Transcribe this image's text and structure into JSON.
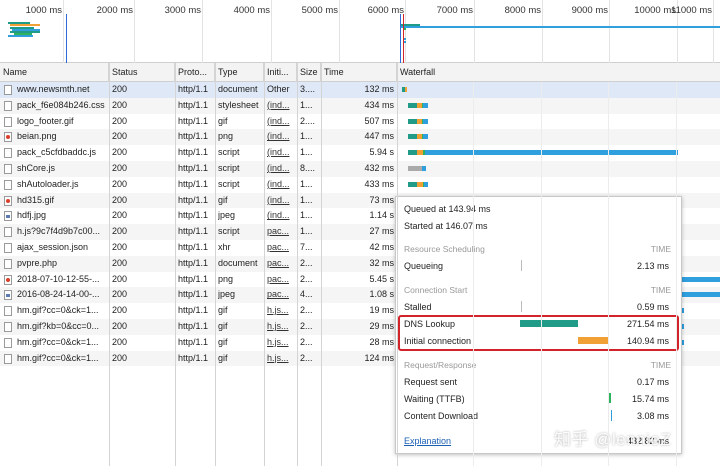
{
  "overview": {
    "tick_labels": [
      "1000 ms",
      "2000 ms",
      "3000 ms",
      "4000 ms",
      "5000 ms",
      "6000 ms",
      "7000 ms",
      "8000 ms",
      "9000 ms",
      "10000 ms",
      "11000 ms"
    ]
  },
  "columns": [
    "Name",
    "Status",
    "Proto...",
    "Type",
    "Initi...",
    "Size",
    "Time",
    "Waterfall"
  ],
  "rows": [
    {
      "name": "www.newsmth.net",
      "status": "200",
      "proto": "http/1.1",
      "type": "document",
      "init": "Other",
      "size": "3....",
      "time": "132 ms",
      "icon": "document-icon"
    },
    {
      "name": "pack_f6e084b246.css",
      "status": "200",
      "proto": "http/1.1",
      "type": "stylesheet",
      "init": "(ind...",
      "size": "1...",
      "time": "434 ms",
      "icon": "stylesheet-icon"
    },
    {
      "name": "logo_footer.gif",
      "status": "200",
      "proto": "http/1.1",
      "type": "gif",
      "init": "(ind...",
      "size": "2....",
      "time": "507 ms",
      "icon": "image-icon"
    },
    {
      "name": "beian.png",
      "status": "200",
      "proto": "http/1.1",
      "type": "png",
      "init": "(ind...",
      "size": "1...",
      "time": "447 ms",
      "icon": "png-icon"
    },
    {
      "name": "pack_c5cfdbaddc.js",
      "status": "200",
      "proto": "http/1.1",
      "type": "script",
      "init": "(ind...",
      "size": "1...",
      "time": "5.94 s",
      "icon": "script-icon"
    },
    {
      "name": "shCore.js",
      "status": "200",
      "proto": "http/1.1",
      "type": "script",
      "init": "(ind...",
      "size": "8....",
      "time": "432 ms",
      "icon": "script-icon"
    },
    {
      "name": "shAutoloader.js",
      "status": "200",
      "proto": "http/1.1",
      "type": "script",
      "init": "(ind...",
      "size": "1...",
      "time": "433 ms",
      "icon": "script-icon"
    },
    {
      "name": "hd315.gif",
      "status": "200",
      "proto": "http/1.1",
      "type": "gif",
      "init": "(ind...",
      "size": "1...",
      "time": "73 ms",
      "icon": "gif-icon"
    },
    {
      "name": "hdfj.jpg",
      "status": "200",
      "proto": "http/1.1",
      "type": "jpeg",
      "init": "(ind...",
      "size": "1...",
      "time": "1.14 s",
      "icon": "jpeg-icon"
    },
    {
      "name": "h.js?9c7f4d9b7c00...",
      "status": "200",
      "proto": "http/1.1",
      "type": "script",
      "init": "pac...",
      "size": "1...",
      "time": "27 ms",
      "icon": "script-icon"
    },
    {
      "name": "ajax_session.json",
      "status": "200",
      "proto": "http/1.1",
      "type": "xhr",
      "init": "pac...",
      "size": "7...",
      "time": "42 ms",
      "icon": "json-icon"
    },
    {
      "name": "pvpre.php",
      "status": "200",
      "proto": "http/1.1",
      "type": "document",
      "init": "pac...",
      "size": "2...",
      "time": "32 ms",
      "icon": "document-icon"
    },
    {
      "name": "2018-07-10-12-55-...",
      "status": "200",
      "proto": "http/1.1",
      "type": "png",
      "init": "pac...",
      "size": "2...",
      "time": "5.45 s",
      "icon": "png-icon"
    },
    {
      "name": "2016-08-24-14-00-...",
      "status": "200",
      "proto": "http/1.1",
      "type": "jpeg",
      "init": "pac...",
      "size": "4...",
      "time": "1.08 s",
      "icon": "jpeg-icon"
    },
    {
      "name": "hm.gif?cc=0&ck=1...",
      "status": "200",
      "proto": "http/1.1",
      "type": "gif",
      "init": "h.js...",
      "size": "2...",
      "time": "19 ms",
      "icon": "gif-icon"
    },
    {
      "name": "hm.gif?kb=0&cc=0...",
      "status": "200",
      "proto": "http/1.1",
      "type": "gif",
      "init": "h.js...",
      "size": "2...",
      "time": "29 ms",
      "icon": "gif-icon"
    },
    {
      "name": "hm.gif?cc=0&ck=1...",
      "status": "200",
      "proto": "http/1.1",
      "type": "gif",
      "init": "h.js...",
      "size": "2...",
      "time": "28 ms",
      "icon": "gif-icon"
    },
    {
      "name": "hm.gif?cc=0&ck=1...",
      "status": "200",
      "proto": "http/1.1",
      "type": "gif",
      "init": "h.js...",
      "size": "2...",
      "time": "124 ms",
      "icon": "gif-icon"
    }
  ],
  "popup": {
    "queued": "Queued at 143.94 ms",
    "started": "Started at 146.07 ms",
    "sections": {
      "resource_scheduling": "Resource Scheduling",
      "connection_start": "Connection Start",
      "request_response": "Request/Response",
      "time_header": "TIME"
    },
    "items": {
      "queueing": {
        "label": "Queueing",
        "value": "2.13 ms"
      },
      "stalled": {
        "label": "Stalled",
        "value": "0.59 ms"
      },
      "dns": {
        "label": "DNS Lookup",
        "value": "271.54 ms"
      },
      "initial": {
        "label": "Initial connection",
        "value": "140.94 ms"
      },
      "sent": {
        "label": "Request sent",
        "value": "0.17 ms"
      },
      "waiting": {
        "label": "Waiting (TTFB)",
        "value": "15.74 ms"
      },
      "download": {
        "label": "Content Download",
        "value": "3.08 ms"
      }
    },
    "explanation": "Explanation",
    "total_partial": "432.82 ms"
  },
  "watermark": "知乎 @lennieZ",
  "colors": {
    "dns": "#1f9b87",
    "initial": "#f0a035",
    "waiting": "#2cb35b",
    "download": "#2f9fde",
    "highlight": "#d2232a",
    "selected_row": "#dfe8f6"
  }
}
